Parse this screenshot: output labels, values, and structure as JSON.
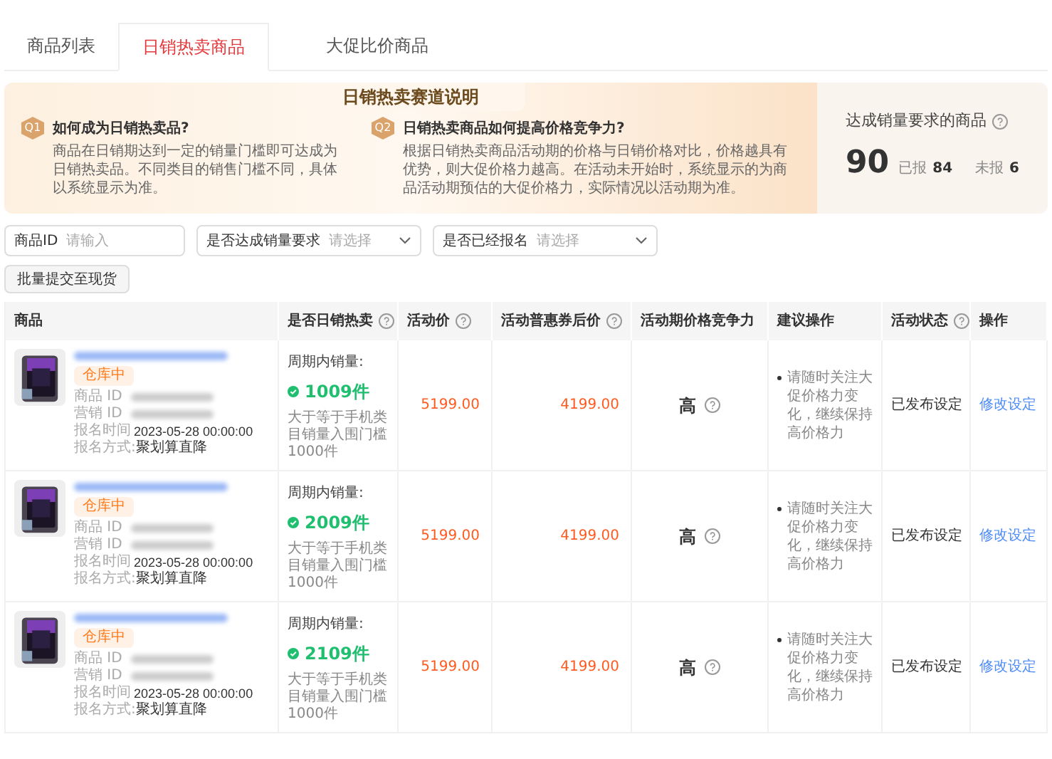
{
  "tabs": [
    {
      "label": "商品列表",
      "selected": false
    },
    {
      "label": "日销热卖商品",
      "selected": true
    },
    {
      "label": "大促比价商品",
      "selected": false
    }
  ],
  "banner": {
    "title": "日销热卖赛道说明",
    "questions": [
      {
        "badge": "Q1",
        "title": "如何成为日销热卖品?",
        "text": "商品在日销期达到一定的销量门槛即可达成为日销热卖品。不同类目的销售门槛不同，具体以系统显示为准。"
      },
      {
        "badge": "Q2",
        "title": "日销热卖商品如何提高价格竞争力?",
        "text": "根据日销热卖商品活动期的价格与日销价格对比，价格越具有优势，则大促价格力越高。在活动未开始时，系统显示的为商品活动期预估的大促价格力，实际情况以活动期为准。"
      }
    ],
    "stat": {
      "label": "达成销量要求的商品",
      "value": "90",
      "signed_label": "已报",
      "signed": "84",
      "unsigned_label": "未报",
      "unsigned": "6"
    }
  },
  "filters": [
    {
      "kind": "input",
      "label": "商品ID",
      "placeholder": "请输入"
    },
    {
      "kind": "select",
      "label": "是否达成销量要求",
      "placeholder": "请选择"
    },
    {
      "kind": "select",
      "label": "是否已经报名",
      "placeholder": "请选择"
    }
  ],
  "batch_button": "批量提交至现货",
  "table": {
    "columns": [
      {
        "label": "商品",
        "help": false
      },
      {
        "label": "是否日销热卖",
        "help": true
      },
      {
        "label": "活动价",
        "help": true
      },
      {
        "label": "活动普惠券后价",
        "help": true
      },
      {
        "label": "活动期价格竞争力",
        "help": false
      },
      {
        "label": "建议操作",
        "help": false
      },
      {
        "label": "活动状态",
        "help": true
      },
      {
        "label": "操作",
        "help": false
      }
    ],
    "rows": [
      {
        "stock_tag": "仓库中",
        "id_label": "商品 ID",
        "marketing_id_label": "营销 ID",
        "time_label": "报名时间",
        "time": "2023-05-28 00:00:00",
        "method_label": "报名方式:",
        "method": "聚划算直降",
        "period_label": "周期内销量:",
        "sales": "1009件",
        "threshold": "大于等于手机类目销量入围门槛1000件",
        "price": "5199.00",
        "coupon_price": "4199.00",
        "competitiveness": "高",
        "suggestion": "请随时关注大促价格力变化，继续保持高价格力",
        "status": "已发布设定",
        "action": "修改设定"
      },
      {
        "stock_tag": "仓库中",
        "id_label": "商品 ID",
        "marketing_id_label": "营销 ID",
        "time_label": "报名时间",
        "time": "2023-05-28 00:00:00",
        "method_label": "报名方式:",
        "method": "聚划算直降",
        "period_label": "周期内销量:",
        "sales": "2009件",
        "threshold": "大于等于手机类目销量入围门槛1000件",
        "price": "5199.00",
        "coupon_price": "4199.00",
        "competitiveness": "高",
        "suggestion": "请随时关注大促价格力变化，继续保持高价格力",
        "status": "已发布设定",
        "action": "修改设定"
      },
      {
        "stock_tag": "仓库中",
        "id_label": "商品 ID",
        "marketing_id_label": "营销 ID",
        "time_label": "报名时间",
        "time": "2023-05-28 00:00:00",
        "method_label": "报名方式:",
        "method": "聚划算直降",
        "period_label": "周期内销量:",
        "sales": "2109件",
        "threshold": "大于等于手机类目销量入围门槛1000件",
        "price": "5199.00",
        "coupon_price": "4199.00",
        "competitiveness": "高",
        "suggestion": "请随时关注大促价格力变化，继续保持高价格力",
        "status": "已发布设定",
        "action": "修改设定"
      }
    ]
  }
}
